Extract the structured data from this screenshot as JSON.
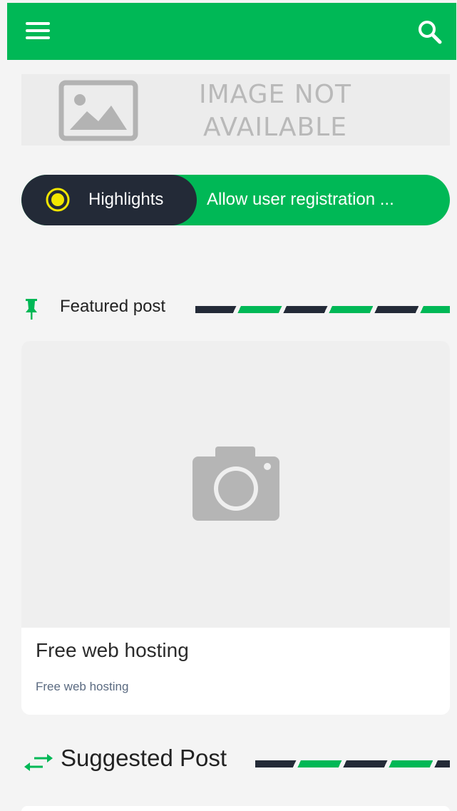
{
  "header": {
    "menu_icon": "hamburger-menu-icon",
    "search_icon": "search-icon",
    "brand_color": "#00b856"
  },
  "banner": {
    "line1": "IMAGE NOT",
    "line2": "AVAILABLE",
    "icon": "image-placeholder-icon"
  },
  "ticker": {
    "label": "Highlights",
    "item": "Allow user registration ...",
    "dot_icon": "pulse-dot-icon",
    "label_bg": "#232a37"
  },
  "featured": {
    "heading": "Featured post",
    "heading_icon": "pin-icon",
    "post_title": "Free web hosting",
    "post_subtitle": "Free web hosting",
    "image_icon": "camera-icon"
  },
  "suggested": {
    "heading": "Suggested Post",
    "heading_icon": "swap-arrows-icon"
  }
}
